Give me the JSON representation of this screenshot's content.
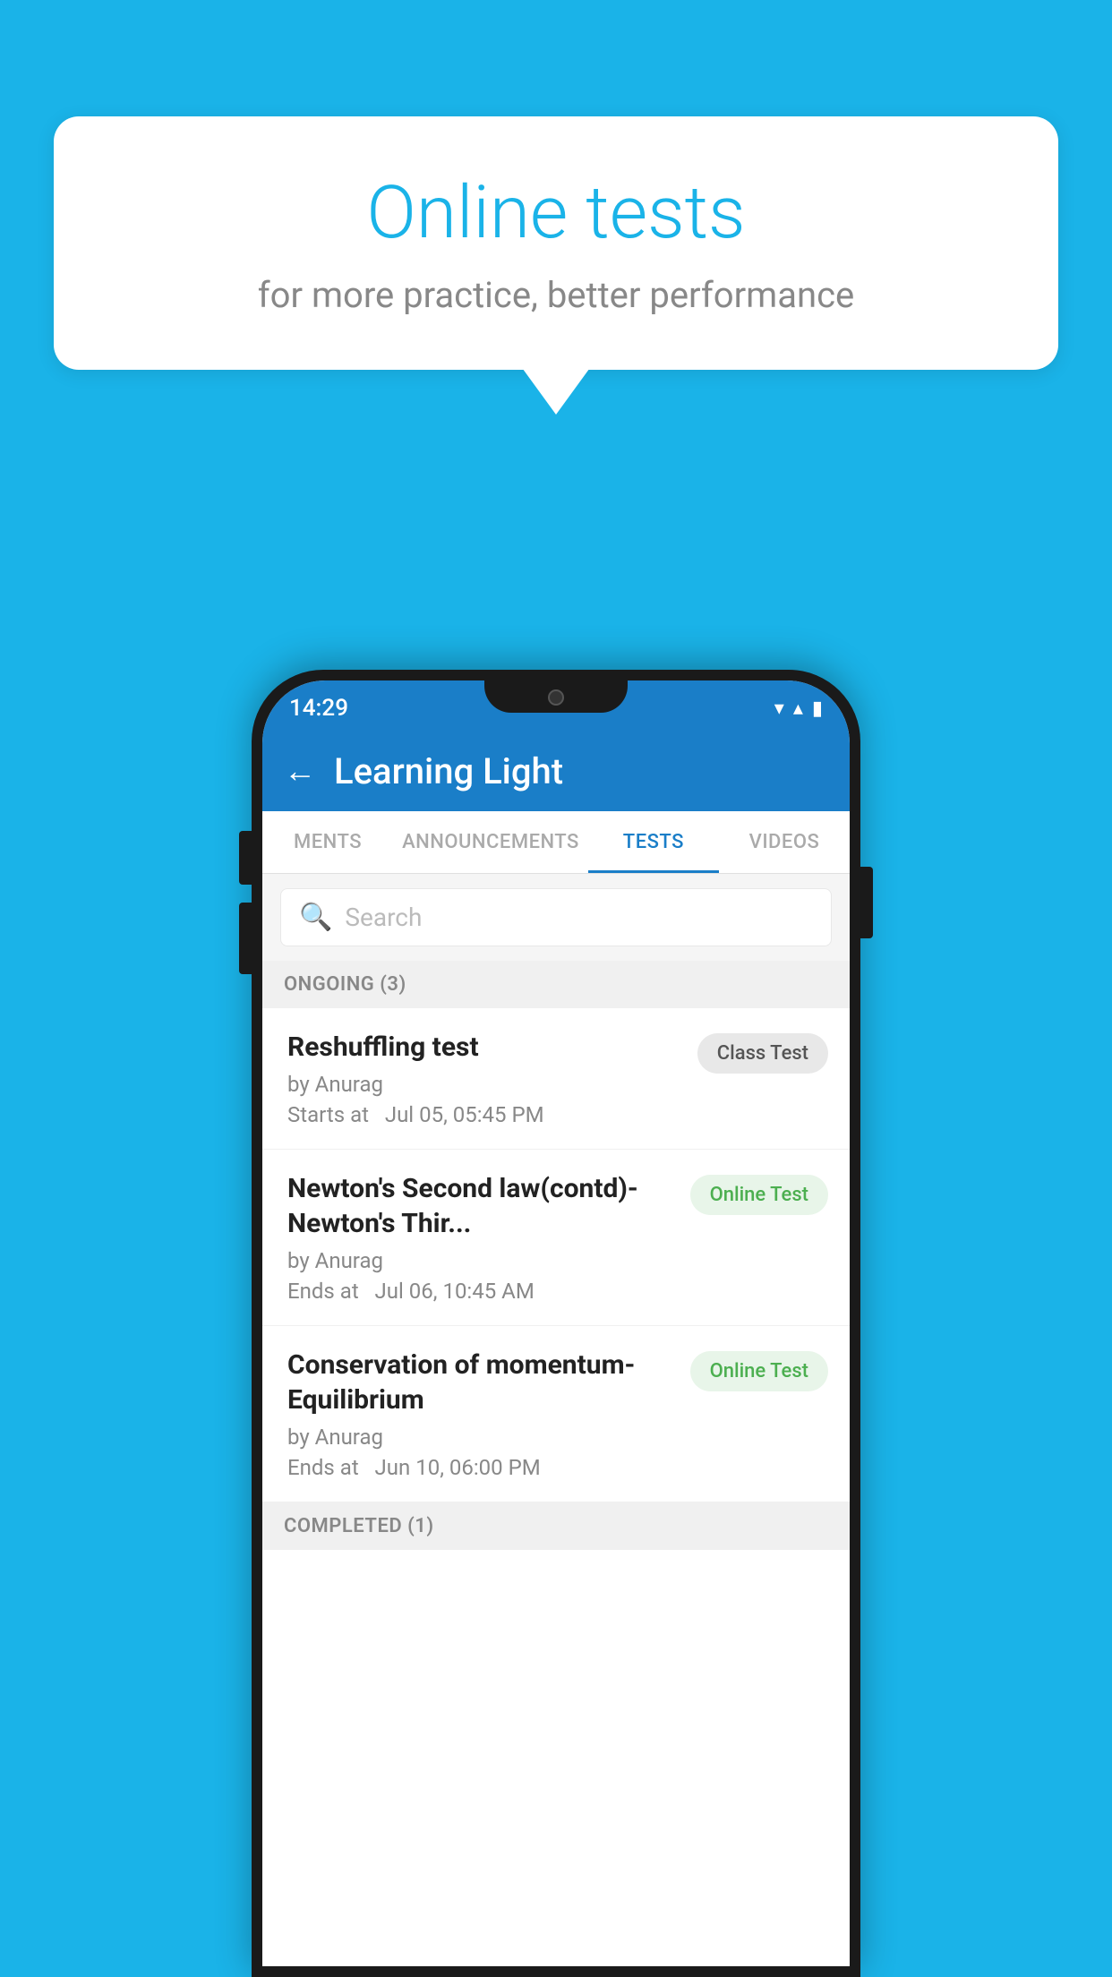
{
  "background": {
    "color": "#1ab3e8"
  },
  "speech_bubble": {
    "title": "Online tests",
    "subtitle": "for more practice, better performance"
  },
  "phone": {
    "status_bar": {
      "time": "14:29",
      "wifi": "▼",
      "signal": "▲",
      "battery": "▮"
    },
    "app_bar": {
      "back_label": "←",
      "title": "Learning Light"
    },
    "tabs": [
      {
        "label": "MENTS",
        "active": false
      },
      {
        "label": "ANNOUNCEMENTS",
        "active": false
      },
      {
        "label": "TESTS",
        "active": true
      },
      {
        "label": "VIDEOS",
        "active": false
      }
    ],
    "search": {
      "placeholder": "Search"
    },
    "sections": [
      {
        "header": "ONGOING (3)",
        "items": [
          {
            "title": "Reshuffling test",
            "author": "by Anurag",
            "time": "Starts at  Jul 05, 05:45 PM",
            "badge": "Class Test",
            "badge_type": "class"
          },
          {
            "title": "Newton's Second law(contd)-Newton's Thir...",
            "author": "by Anurag",
            "time": "Ends at  Jul 06, 10:45 AM",
            "badge": "Online Test",
            "badge_type": "online"
          },
          {
            "title": "Conservation of momentum-Equilibrium",
            "author": "by Anurag",
            "time": "Ends at  Jun 10, 06:00 PM",
            "badge": "Online Test",
            "badge_type": "online"
          }
        ]
      },
      {
        "header": "COMPLETED (1)",
        "items": []
      }
    ]
  }
}
